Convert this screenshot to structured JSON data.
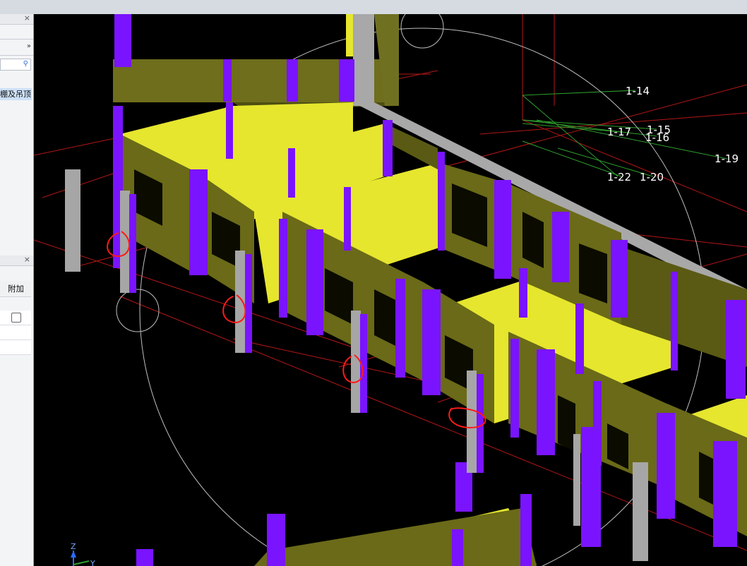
{
  "left_panel": {
    "close_glyph": "×",
    "expand_glyph": "»",
    "search_icon": "⚲",
    "tree_item_label": "棚及吊顶",
    "lower_close_glyph": "×",
    "column_header": "附加",
    "rows": [
      {
        "checkbox": true
      },
      {
        "checkbox": false
      },
      {
        "checkbox": false
      }
    ]
  },
  "viewport": {
    "background": "#000000",
    "axis_labels": {
      "z": "Z",
      "y": "Y"
    },
    "grid_labels": [
      {
        "text": "1-14"
      },
      {
        "text": "1-17"
      },
      {
        "text": "1-15"
      },
      {
        "text": "1-16"
      },
      {
        "text": "1-19"
      },
      {
        "text": "1-22"
      },
      {
        "text": "1-20"
      }
    ],
    "colors": {
      "wall": "#e6e62e",
      "wall_dark": "#7f7f1f",
      "column": "#7a14ff",
      "post": "#a6a6a6",
      "grid_red": "#c21b1b",
      "grid_green": "#2ea02e",
      "annotation": "#ff1a1a"
    }
  }
}
